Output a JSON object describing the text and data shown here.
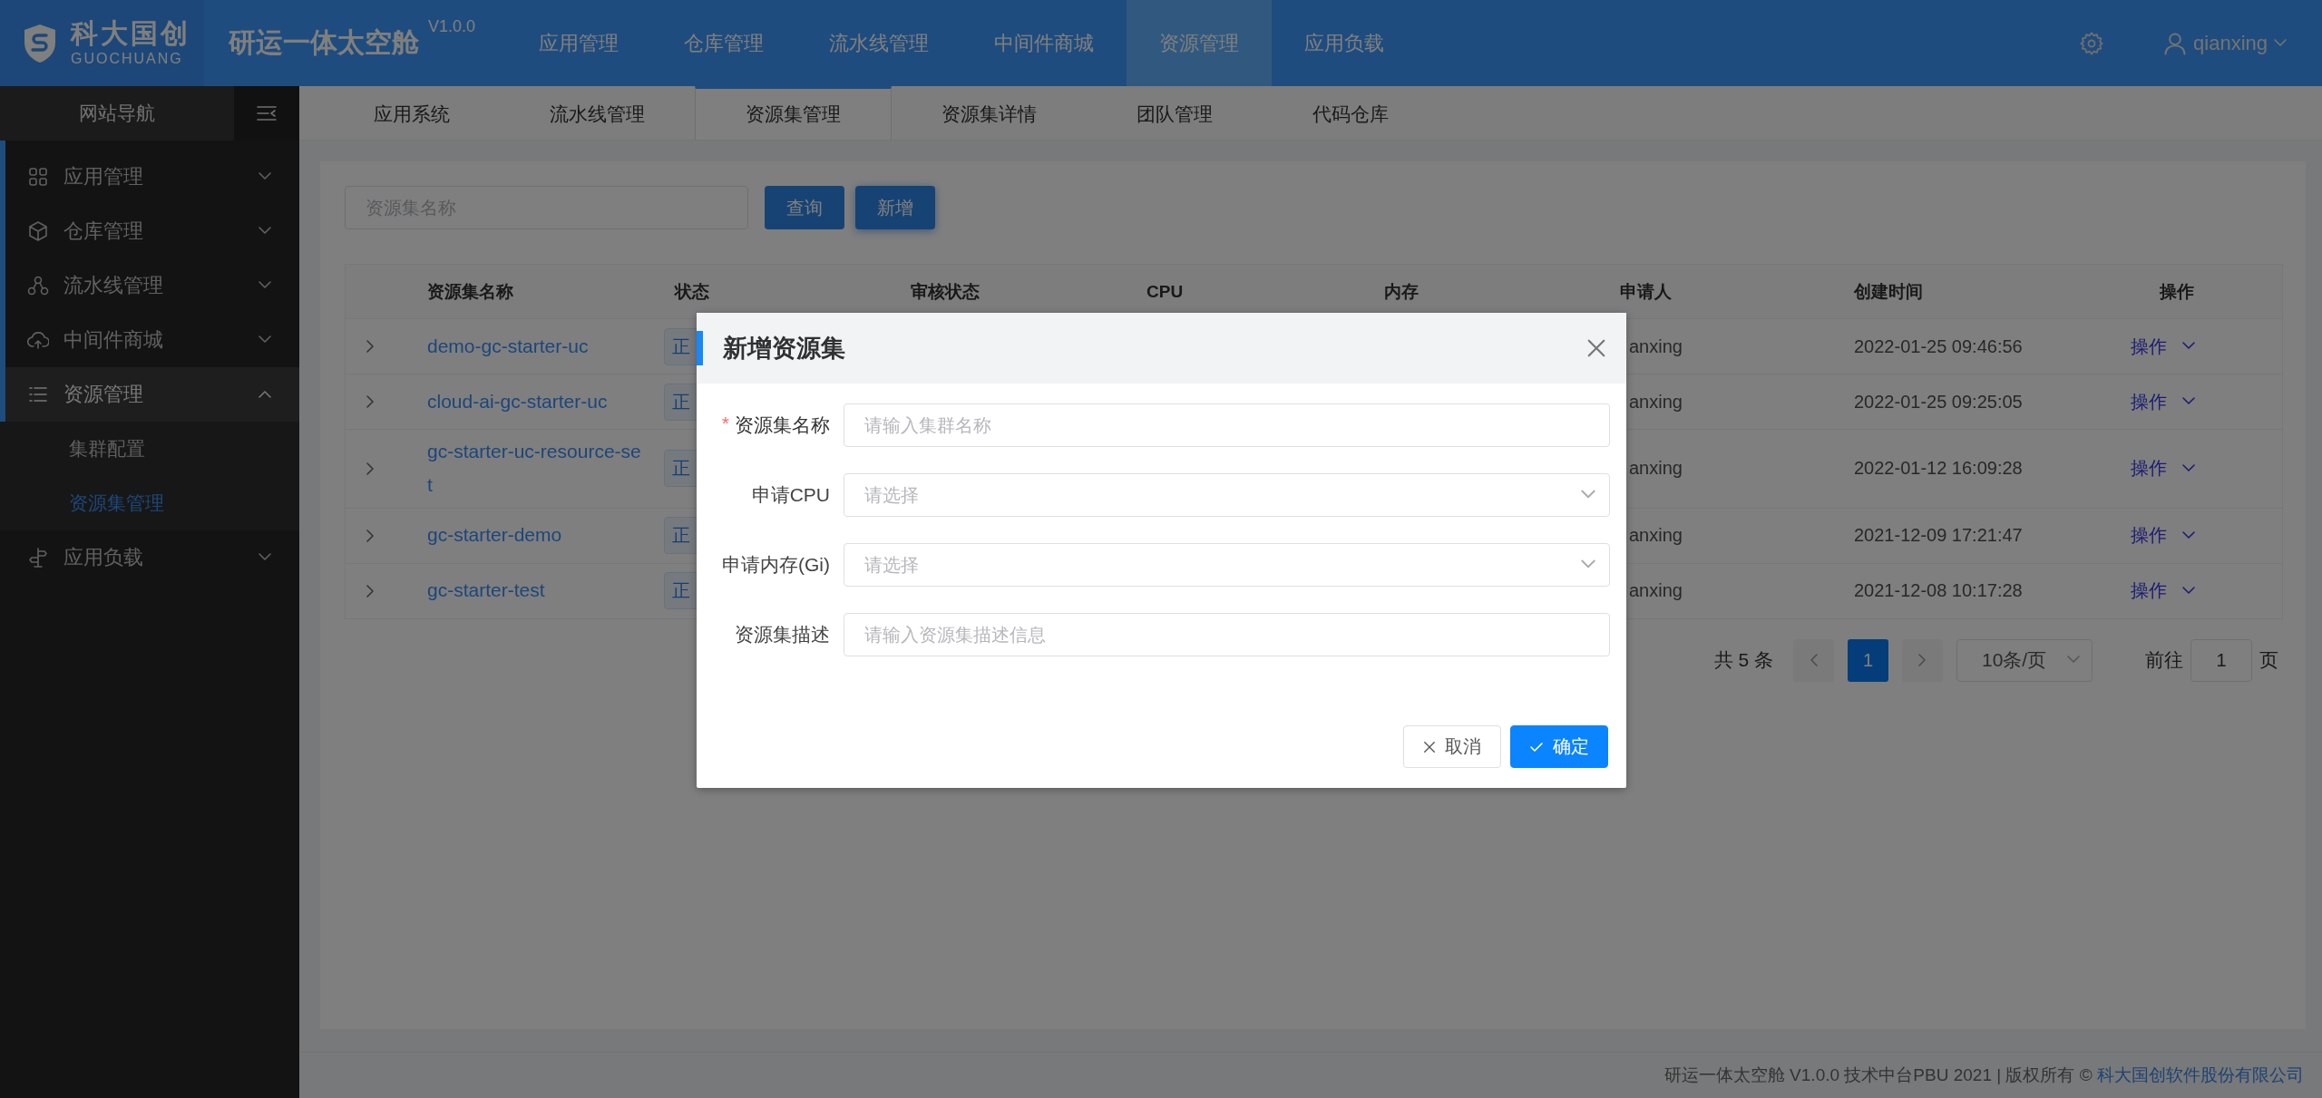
{
  "header": {
    "logo": {
      "name": "科大国创",
      "sub": "GUOCHUANG"
    },
    "title": "研运一体太空舱",
    "version": "V1.0.0",
    "nav": [
      {
        "label": "应用管理",
        "selected": false
      },
      {
        "label": "仓库管理",
        "selected": false
      },
      {
        "label": "流水线管理",
        "selected": false
      },
      {
        "label": "中间件商城",
        "selected": false
      },
      {
        "label": "资源管理",
        "selected": true
      },
      {
        "label": "应用负载",
        "selected": false
      }
    ],
    "user": {
      "name": "qianxing"
    }
  },
  "sidebar": {
    "title": "网站导航",
    "items": [
      {
        "label": "应用管理",
        "expanded": false
      },
      {
        "label": "仓库管理",
        "expanded": false
      },
      {
        "label": "流水线管理",
        "expanded": false
      },
      {
        "label": "中间件商城",
        "expanded": false
      },
      {
        "label": "资源管理",
        "expanded": true,
        "children": [
          {
            "label": "集群配置",
            "selected": false
          },
          {
            "label": "资源集管理",
            "selected": true
          }
        ]
      },
      {
        "label": "应用负载",
        "expanded": false
      }
    ]
  },
  "tabs": [
    {
      "label": "应用系统",
      "selected": false
    },
    {
      "label": "流水线管理",
      "selected": false
    },
    {
      "label": "资源集管理",
      "selected": true
    },
    {
      "label": "资源集详情",
      "selected": false
    },
    {
      "label": "团队管理",
      "selected": false
    },
    {
      "label": "代码仓库",
      "selected": false
    }
  ],
  "search": {
    "placeholder": "资源集名称"
  },
  "search_buttons": [
    {
      "label": "查询",
      "focused": false
    },
    {
      "label": "新增",
      "focused": true
    }
  ],
  "table": {
    "columns": [
      "资源集名称",
      "状态",
      "审核状态",
      "CPU",
      "内存",
      "申请人",
      "创建时间",
      "操作"
    ],
    "rows": [
      {
        "name": "demo-gc-starter-uc",
        "status": "正",
        "applicant": "anxing",
        "created": "2022-01-25 09:46:56",
        "action": "操作"
      },
      {
        "name": "cloud-ai-gc-starter-uc",
        "status": "正",
        "applicant": "anxing",
        "created": "2022-01-25 09:25:05",
        "action": "操作"
      },
      {
        "name": "gc-starter-uc-resource-set",
        "status": "正",
        "applicant": "anxing",
        "created": "2022-01-12 16:09:28",
        "action": "操作"
      },
      {
        "name": "gc-starter-demo",
        "status": "正",
        "applicant": "anxing",
        "created": "2021-12-09 17:21:47",
        "action": "操作"
      },
      {
        "name": "gc-starter-test",
        "status": "正",
        "applicant": "anxing",
        "created": "2021-12-08 10:17:28",
        "action": "操作"
      }
    ]
  },
  "pagination": {
    "total": "共 5 条",
    "pages": [
      {
        "label": "1",
        "selected": true
      }
    ],
    "page_size": "10条/页",
    "goto_label": "前往",
    "goto_value": "1",
    "goto_unit": "页"
  },
  "footer": {
    "text": "研运一体太空舱 V1.0.0 技术中台PBU 2021 | 版权所有 © ",
    "link": "科大国创软件股份有限公司"
  },
  "dialog": {
    "title": "新增资源集",
    "required_mark": "*",
    "fields": [
      {
        "label": "资源集名称",
        "required": true,
        "kind": "input",
        "placeholder": "请输入集群名称"
      },
      {
        "label": "申请CPU",
        "required": false,
        "kind": "select",
        "placeholder": "请选择"
      },
      {
        "label": "申请内存(Gi)",
        "required": false,
        "kind": "select",
        "placeholder": "请选择"
      },
      {
        "label": "资源集描述",
        "required": false,
        "kind": "input",
        "placeholder": "请输入资源集描述信息"
      }
    ],
    "buttons": [
      {
        "label": "取消",
        "kind": "cancel"
      },
      {
        "label": "确定",
        "kind": "confirm"
      }
    ]
  }
}
